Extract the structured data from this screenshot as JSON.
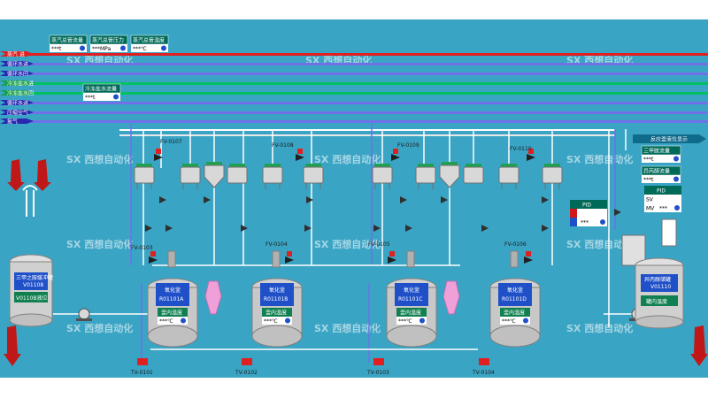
{
  "colors": {
    "background": "#3aa4c4",
    "pipe_red": "#e02020",
    "pipe_blue": "#7070e8",
    "pipe_green": "#00c060",
    "pipe_cyan": "#30d0e0",
    "panel_green": "#006a58",
    "display_blue": "#2050c8",
    "display_green": "#108050",
    "arrow_red": "#c01818"
  },
  "left_arrows": [
    {
      "label": "蒸汽  进",
      "color": "#e02020"
    },
    {
      "label": "循环水进",
      "color": "#2828b0"
    },
    {
      "label": "循环水回",
      "color": "#2828b0"
    },
    {
      "label": "冷冻盐水进",
      "color": "#18a048"
    },
    {
      "label": "冷冻盐水回",
      "color": "#18a048"
    },
    {
      "label": "循环水进",
      "color": "#2828b0"
    },
    {
      "label": "压缩空气",
      "color": "#2828b0"
    },
    {
      "label": "氮气",
      "color": "#2828b0"
    }
  ],
  "top_panels": [
    {
      "title": "蒸汽总管流量",
      "value": "***t",
      "unit": "t"
    },
    {
      "title": "蒸汽总管压力",
      "value": "***MPa",
      "unit": "MPa"
    },
    {
      "title": "蒸汽总管温度",
      "value": "***℃",
      "unit": "℃"
    }
  ],
  "chilled_panel": {
    "title": "冷冻盐水流量",
    "value": "***t"
  },
  "valves": {
    "fv": [
      "FV-0107",
      "FV-0108",
      "FV-0109",
      "FV-0110",
      "FV-0103",
      "FV-0104",
      "FV-0105",
      "FV-0106"
    ],
    "tv": [
      "TV-0101",
      "TV-0102",
      "TV-0103",
      "TV-0104"
    ]
  },
  "left_tank": {
    "name": "三甲之胺缓冲罐",
    "id": "V01108",
    "display": "V0110B液位"
  },
  "right_tank": {
    "name": "异丙醇储罐",
    "id": "V01110",
    "display": "罐内温度"
  },
  "reactors": [
    {
      "name": "氧化釜",
      "id": "R01101A",
      "display": "釜内温度",
      "value": "***℃"
    },
    {
      "name": "氧化釜",
      "id": "R01101B",
      "display": "釜内温度",
      "value": "***℃"
    },
    {
      "name": "氧化釜",
      "id": "R01101C",
      "display": "釜内温度",
      "value": "***℃"
    },
    {
      "name": "氧化釜",
      "id": "R01101D",
      "display": "釜内温度",
      "value": "***℃"
    }
  ],
  "right_panels": {
    "status_banner": "反应釜液位显示",
    "panel1": {
      "title": "三甲胺流量",
      "value": "***t"
    },
    "panel2": {
      "title": "异丙醇流量",
      "value": "***t"
    },
    "pid": {
      "title": "PID",
      "sp_label": "SV",
      "mv_label": "MV",
      "value": "***"
    }
  },
  "watermark": "西想自动化"
}
